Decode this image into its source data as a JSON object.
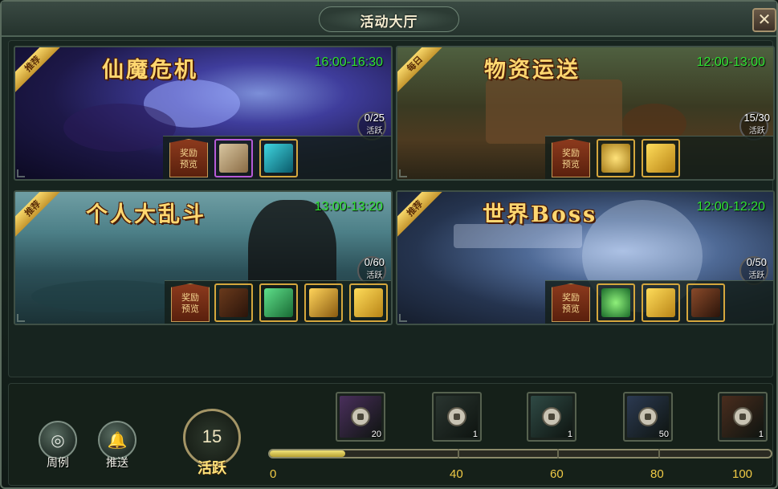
{
  "window": {
    "title": "活动大厅",
    "close_label": "✕"
  },
  "cards": [
    {
      "name": "仙魔危机",
      "time": "16:00-16:30",
      "ribbon": "推荐",
      "progress": "0/25",
      "progress_label": "活跃",
      "reward_label_line1": "奖励",
      "reward_label_line2": "预览",
      "rewards": [
        {
          "icon": "scroll-icon",
          "count": ""
        },
        {
          "icon": "jade-token-icon",
          "count": ""
        }
      ]
    },
    {
      "name": "物资运送",
      "time": "12:00-13:00",
      "ribbon": "每日",
      "progress": "15/30",
      "progress_label": "活跃",
      "reward_label_line1": "奖励",
      "reward_label_line2": "预览",
      "rewards": [
        {
          "icon": "coin-icon",
          "count": ""
        },
        {
          "icon": "gold-ticket-icon",
          "count": ""
        }
      ]
    },
    {
      "name": "个人大乱斗",
      "time": "13:00-13:20",
      "ribbon": "推荐",
      "progress": "0/60",
      "progress_label": "活跃",
      "reward_label_line1": "奖励",
      "reward_label_line2": "预览",
      "rewards": [
        {
          "icon": "armor-icon",
          "count": ""
        },
        {
          "icon": "green-jade-icon",
          "count": ""
        },
        {
          "icon": "gold-armor-icon",
          "count": ""
        },
        {
          "icon": "gold-ticket-icon",
          "count": ""
        }
      ]
    },
    {
      "name": "世界Boss",
      "time": "12:00-12:20",
      "ribbon": "推荐",
      "progress": "0/50",
      "progress_label": "活跃",
      "reward_label_line1": "奖励",
      "reward_label_line2": "预览",
      "rewards": [
        {
          "icon": "green-orb-icon",
          "count": ""
        },
        {
          "icon": "gold-ticket-icon",
          "count": ""
        },
        {
          "icon": "warrior-icon",
          "count": ""
        }
      ]
    }
  ],
  "bottom": {
    "weekly_label": "周例",
    "push_label": "推送",
    "active_value": "15",
    "active_label": "活跃",
    "progress_fraction": 0.15,
    "ticks": [
      "0",
      "40",
      "60",
      "80",
      "100"
    ],
    "chests": [
      {
        "count": "20",
        "color": "#4a2f5c"
      },
      {
        "count": "1",
        "color": "#2a3530"
      },
      {
        "count": "1",
        "color": "#2f4a45"
      },
      {
        "count": "50",
        "color": "#2c3a52"
      },
      {
        "count": "1",
        "color": "#4a2d1e"
      }
    ]
  }
}
